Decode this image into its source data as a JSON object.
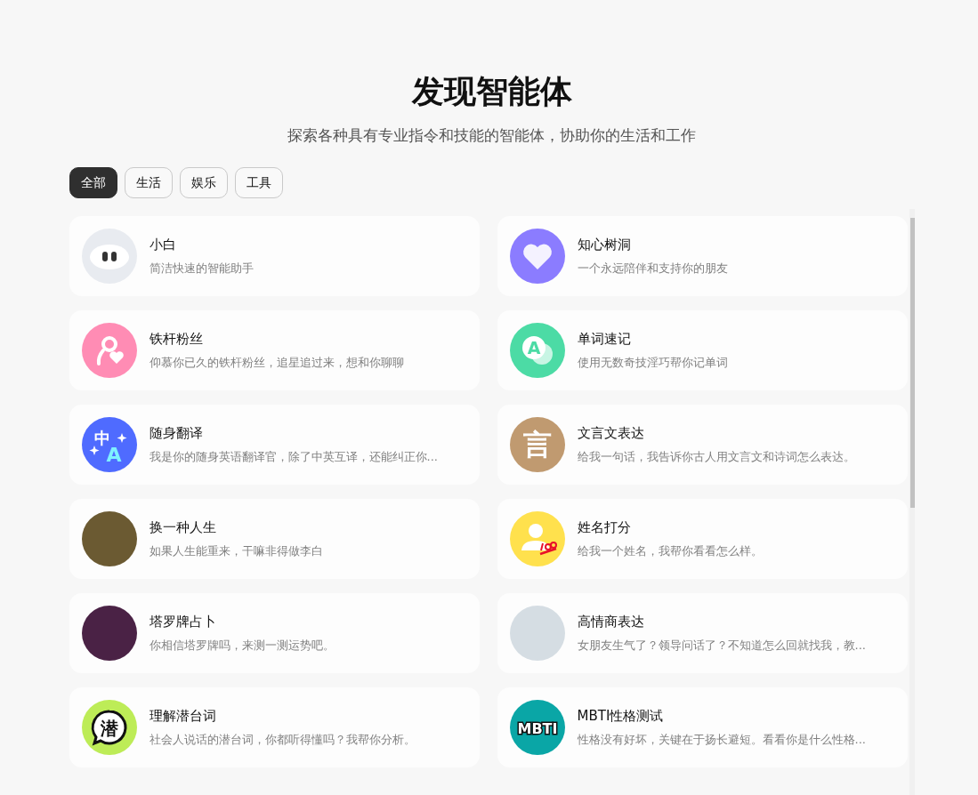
{
  "header": {
    "title": "发现智能体",
    "subtitle": "探索各种具有专业指令和技能的智能体，协助你的生活和工作"
  },
  "tabs": [
    {
      "label": "全部",
      "selected": true
    },
    {
      "label": "生活",
      "selected": false
    },
    {
      "label": "娱乐",
      "selected": false
    },
    {
      "label": "工具",
      "selected": false
    }
  ],
  "agents": [
    {
      "name": "小白",
      "description": "简洁快速的智能助手",
      "avatar": {
        "kind": "face",
        "color": "#e8ebf0"
      }
    },
    {
      "name": "知心树洞",
      "description": "一个永远陪伴和支持你的朋友",
      "avatar": {
        "kind": "heart",
        "color": "#8b7cff"
      }
    },
    {
      "name": "铁杆粉丝",
      "description": "仰慕你已久的铁杆粉丝，追星追过来，想和你聊聊",
      "avatar": {
        "kind": "fan",
        "color": "#ff8cb4"
      }
    },
    {
      "name": "单词速记",
      "description": "使用无数奇技淫巧帮你记单词",
      "avatar": {
        "kind": "bubble",
        "color": "#4cdba5",
        "text": "A"
      }
    },
    {
      "name": "随身翻译",
      "description": "我是你的随身英语翻译官，除了中英互译，还能纠正你...",
      "avatar": {
        "kind": "translate",
        "color": "#4f6bff",
        "text": "中",
        "text2": "A"
      }
    },
    {
      "name": "文言文表达",
      "description": "给我一句话，我告诉你古人用文言文和诗词怎么表达。",
      "avatar": {
        "kind": "glyph",
        "color": "#c09a70",
        "text": "言"
      }
    },
    {
      "name": "换一种人生",
      "description": "如果人生能重来，干嘛非得做李白",
      "avatar": {
        "kind": "photo",
        "color": "#6b5a32"
      }
    },
    {
      "name": "姓名打分",
      "description": "给我一个姓名，我帮你看看怎么样。",
      "avatar": {
        "kind": "score",
        "color": "#ffe14d"
      }
    },
    {
      "name": "塔罗牌占卜",
      "description": "你相信塔罗牌吗，来测一测运势吧。",
      "avatar": {
        "kind": "photo",
        "color": "#4a2245"
      }
    },
    {
      "name": "高情商表达",
      "description": "女朋友生气了？领导问话了？不知道怎么回就找我，教...",
      "avatar": {
        "kind": "photo",
        "color": "#d5dde3"
      }
    },
    {
      "name": "理解潜台词",
      "description": "社会人说话的潜台词，你都听得懂吗？我帮你分析。",
      "avatar": {
        "kind": "speech",
        "color": "#bdec57",
        "text": "潜"
      }
    },
    {
      "name": "MBTI性格测试",
      "description": "性格没有好坏，关键在于扬长避短。看看你是什么性格...",
      "avatar": {
        "kind": "glyph",
        "color": "#0aa6a6",
        "text": "MBTI"
      }
    }
  ]
}
